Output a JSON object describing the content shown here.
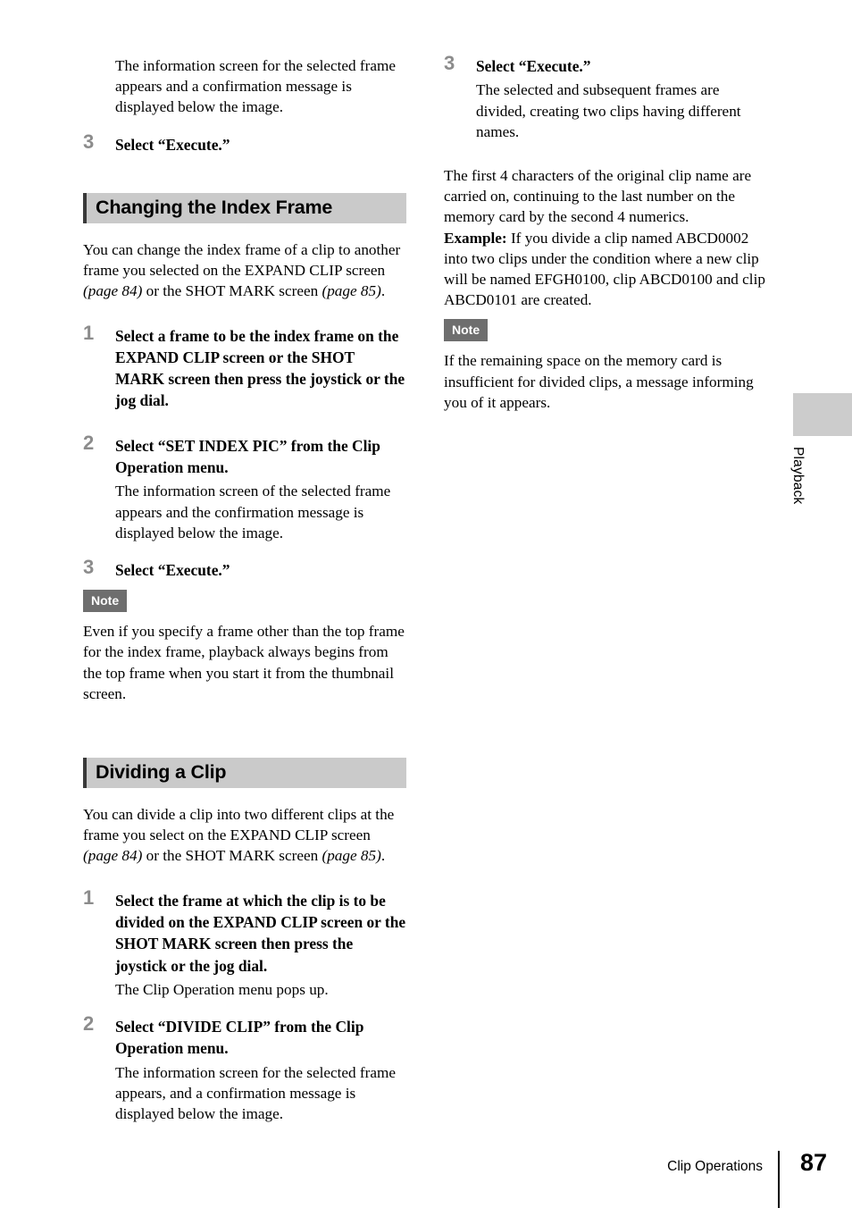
{
  "page": {
    "number": "87",
    "chapter_footer": "Clip Operations",
    "side_tab_label": "Playback"
  },
  "left_column": {
    "intro_paragraph": "The information screen for the selected frame appears and a confirmation message is displayed below the image.",
    "step3_top": {
      "number": "3",
      "title": "Select “Execute.”"
    },
    "section1": {
      "heading": "Changing the Index Frame",
      "intro_a": "You can change the index frame of a clip to another frame you selected on the EXPAND CLIP screen ",
      "intro_ref1": "(page 84)",
      "intro_b": " or the SHOT MARK screen ",
      "intro_ref2": "(page 85)",
      "intro_c": ".",
      "steps": [
        {
          "number": "1",
          "title": "Select a frame to be the index frame on the EXPAND CLIP screen or the SHOT MARK screen then press the joystick or the jog dial.",
          "body": ""
        },
        {
          "number": "2",
          "title": "Select “SET INDEX PIC” from the Clip Operation menu.",
          "body": "The information screen of the selected frame appears and the confirmation message is displayed below the image."
        },
        {
          "number": "3",
          "title": "Select “Execute.”",
          "body": ""
        }
      ],
      "note_label": "Note",
      "note_text": "Even if you specify a frame other than the top frame for the index frame, playback always begins from the top frame when you start it from the thumbnail screen."
    },
    "section2": {
      "heading": "Dividing a Clip",
      "intro_a": "You can divide a clip into two different clips at the frame you select on the EXPAND CLIP screen ",
      "intro_ref1": "(page 84)",
      "intro_b": " or the SHOT MARK screen ",
      "intro_ref2": "(page 85)",
      "intro_c": ".",
      "steps": [
        {
          "number": "1",
          "title": "Select the frame at which the clip is to be divided on the EXPAND CLIP screen or the SHOT MARK screen then press the joystick or the jog dial.",
          "body": "The Clip Operation menu pops up."
        },
        {
          "number": "2",
          "title": "Select “DIVIDE CLIP” from the Clip Operation menu.",
          "body": "The information screen for the selected frame appears, and a confirmation message is displayed below the image."
        }
      ]
    }
  },
  "right_column": {
    "step3": {
      "number": "3",
      "title": "Select “Execute.”",
      "body": "The selected and subsequent frames are divided, creating two clips having different names."
    },
    "naming_paragraph": "The first 4 characters of the original clip name are carried on, continuing to the last number on the memory card by the second 4 numerics.",
    "example_label": "Example:",
    "example_text": " If you divide a clip named ABCD0002 into two clips under the condition where a new clip will be named EFGH0100, clip ABCD0100 and clip ABCD0101 are created.",
    "note_label": "Note",
    "note_text": "If the remaining space on the memory card is insufficient for divided clips, a message informing you of it appears."
  }
}
